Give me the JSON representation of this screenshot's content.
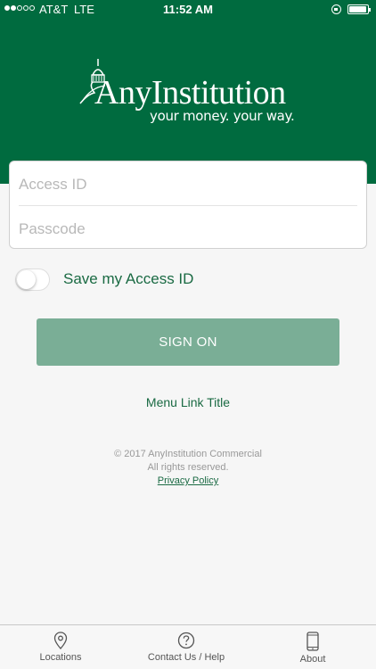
{
  "status_bar": {
    "carrier": "AT&T",
    "network": "LTE",
    "time": "11:52 AM",
    "battery_level": 0.95
  },
  "logo": {
    "name": "AnyInstitution",
    "tagline": "your money. your way."
  },
  "login": {
    "access_id_placeholder": "Access ID",
    "access_id_value": "",
    "passcode_placeholder": "Passcode",
    "passcode_value": ""
  },
  "save_access_id": {
    "label": "Save my Access ID",
    "enabled": false
  },
  "sign_on": {
    "label": "SIGN ON"
  },
  "menu_link": {
    "label": "Menu Link Title"
  },
  "footer": {
    "copyright": "© 2017 AnyInstitution Commercial",
    "rights": "All rights reserved.",
    "privacy": "Privacy Policy"
  },
  "tabs": [
    {
      "label": "Locations",
      "icon": "location-pin-icon"
    },
    {
      "label": "Contact Us / Help",
      "icon": "help-circle-icon"
    },
    {
      "label": "About",
      "icon": "phone-device-icon"
    }
  ],
  "colors": {
    "brand": "#006b3f",
    "button": "#7aae96",
    "link": "#1a6a43",
    "background": "#f6f6f6"
  }
}
